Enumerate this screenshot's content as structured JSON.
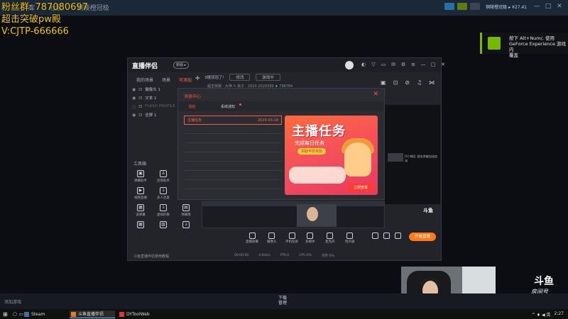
{
  "steam": {
    "nav": [
      "库",
      "社区",
      "铜陵橙冠极"
    ],
    "username": "铜陵橙冠极 ▸ ¥27.41",
    "bottom_add_game": "添加游戏",
    "downloads_label": "下载",
    "downloads_sub": "管理"
  },
  "overlay": {
    "line1": "粉丝群:  787080697",
    "line2": "超击突破pw殿",
    "line3": "V:CJTP-666666"
  },
  "nvidia_toast": {
    "line1": "按下 Alt+Num/, 使用",
    "line2": "GeForce Experience 游戏内",
    "line3": "覆盖"
  },
  "app": {
    "logo": "直播伴侣",
    "version_badge": "新版 ▸",
    "left_tabs": [
      "我的场景",
      "场景",
      "可添加"
    ],
    "scenes": [
      {
        "label": "摄像头 1",
        "dim": false
      },
      {
        "label": "文本 1",
        "dim": false
      },
      {
        "label": "FLASH PROFILE",
        "dim": true
      },
      {
        "label": "全屏 1",
        "dim": false
      }
    ],
    "tools_header": "工具箱",
    "tools": [
      "弹幕助手",
      "房管助手",
      "",
      "视频直播",
      "多人连麦",
      "横屏助手",
      "谈弹幕",
      "虚拟形象",
      "弹幕库",
      "",
      "",
      ""
    ],
    "left_bottom": "斗鱼直播伴侣使用教程",
    "stream_title": "3楼双冠了!",
    "stream_btn": "修改",
    "stream_mode": "游戏中",
    "stream_info_row": "超击突破 · 大神  ✎   房子 · 2020  2020339   ♦ 798764",
    "dialog": {
      "title": "消息中心",
      "tabs": [
        "活动",
        "系统通知"
      ],
      "rows": [
        {
          "label": "主播任务",
          "date": "2020-03-18"
        },
        {
          "label": "",
          "date": ""
        },
        {
          "label": "",
          "date": ""
        },
        {
          "label": "",
          "date": ""
        },
        {
          "label": "",
          "date": ""
        },
        {
          "label": "",
          "date": ""
        },
        {
          "label": "",
          "date": ""
        },
        {
          "label": "",
          "date": ""
        }
      ],
      "banner_title": "主播任务",
      "banner_sub": "完成每日任务",
      "banner_cta": "领取丰厚奖励",
      "banner_btn": "立即查看"
    },
    "chat_line": "[V] 喊话: 超击突破加油加油",
    "preview_logo": "斗鱼",
    "bottom_items": [
      "直播屏幕",
      "摄像头",
      "手机投屏",
      "多媒体",
      "麦克风",
      "扬声器"
    ],
    "start_button": "开始直播",
    "status": [
      "00:00:00",
      "0.0kb/s",
      "FPS:0",
      "CPU:0%",
      "内存:0%"
    ]
  },
  "douyu": {
    "logo": "斗鱼",
    "sub": "房间号",
    "room": "2020339"
  },
  "taskbar": {
    "tasks": [
      "Steam",
      "斗鱼直播伴侣",
      "DYToolWeb"
    ],
    "clock": "2:27",
    "tray": "^ ♦ ◀ 英"
  }
}
